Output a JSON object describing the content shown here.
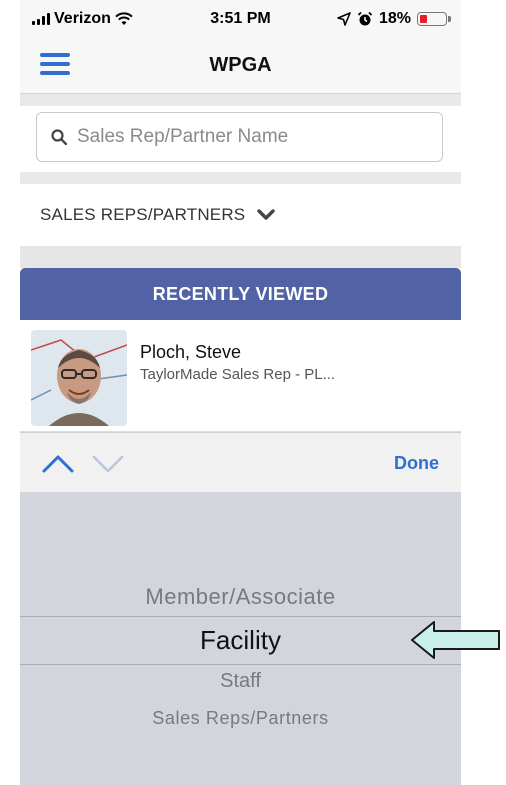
{
  "status_bar": {
    "carrier": "Verizon",
    "time": "3:51 PM",
    "battery": "18%"
  },
  "nav": {
    "title": "WPGA"
  },
  "search": {
    "placeholder": "Sales Rep/Partner Name"
  },
  "filter": {
    "label": "SALES REPS/PARTNERS"
  },
  "recently_viewed": {
    "header": "RECENTLY VIEWED",
    "items": [
      {
        "name": "Ploch, Steve",
        "subtitle": "TaylorMade Sales Rep - PL..."
      }
    ]
  },
  "toolbar": {
    "done_label": "Done"
  },
  "picker": {
    "options": [
      "Member/Associate",
      "Facility",
      "Staff",
      "Sales Reps/Partners"
    ],
    "selected": "Facility"
  },
  "colors": {
    "accent": "#2f6fd0",
    "header_bg": "#5263a5",
    "battery_low": "#e4202a",
    "annotation_arrow": "#c9f0ec"
  }
}
